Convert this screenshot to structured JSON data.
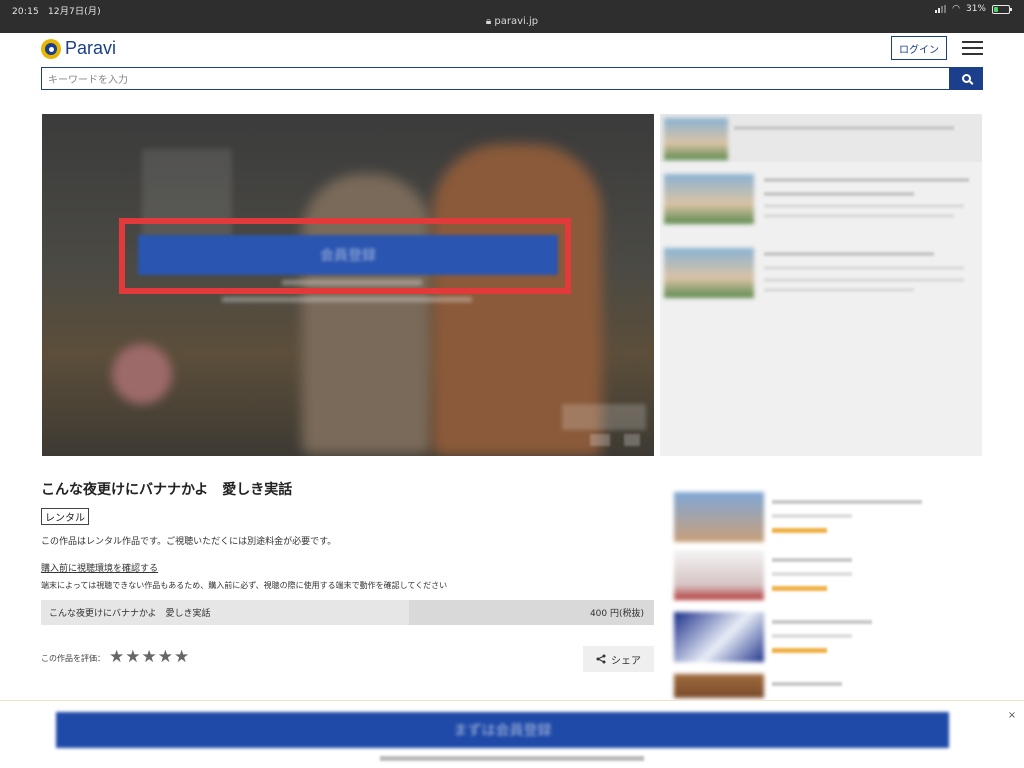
{
  "status_bar": {
    "time": "20:15",
    "date": "12月7日(月)",
    "url": "paravi.jp",
    "battery_text": "31%",
    "battery_level": 0.31
  },
  "header": {
    "logo_text": "Paravi",
    "login_label": "ログイン",
    "search_placeholder": "キーワードを入力"
  },
  "player": {
    "register_label": "会員登録"
  },
  "content": {
    "title": "こんな夜更けにバナナかよ　愛しき実話",
    "badge": "レンタル",
    "description": "この作品はレンタル作品です。ご視聴いただくには別途料金が必要です。",
    "check_link": "購入前に視聴環境を確認する",
    "check_note": "端末によっては視聴できない作品もあるため、購入前に必ず、視聴の際に使用する端末で動作を確認してください",
    "price_item_name": "こんな夜更けにバナナかよ　愛しき実話",
    "price": "400 円(税抜)",
    "rate_label": "この作品を評価：",
    "share_label": "シェア"
  },
  "bottom_bar": {
    "cta_label": "まずは会員登録",
    "close_label": "×"
  },
  "colors": {
    "brand_blue": "#1b3f8b",
    "highlight_red": "#e23a3a",
    "logo_yellow": "#e8b600"
  },
  "icons": {
    "search": "search-icon",
    "menu": "hamburger-menu-icon",
    "share": "share-icon",
    "wifi": "wifi-icon",
    "signal": "signal-icon",
    "battery": "battery-icon",
    "lock": "lock-icon",
    "star": "star-icon"
  }
}
